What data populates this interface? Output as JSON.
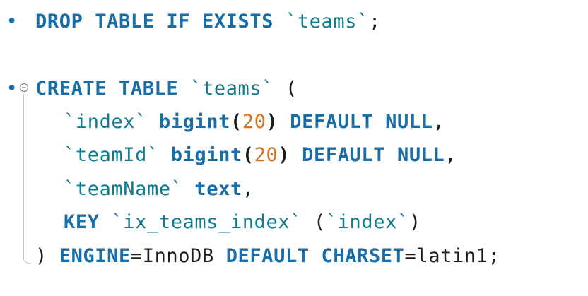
{
  "editor": {
    "lines": [
      {
        "tokens": [
          {
            "t": "kw",
            "v": "DROP TABLE IF EXISTS "
          },
          {
            "t": "id",
            "v": "`teams`"
          },
          {
            "t": "plain",
            "v": ";"
          }
        ]
      },
      {
        "tokens": [
          {
            "t": "kw",
            "v": "CREATE TABLE "
          },
          {
            "t": "id",
            "v": "`teams`"
          },
          {
            "t": "plain",
            "v": " ("
          }
        ]
      },
      {
        "tokens": [
          {
            "t": "id",
            "v": "`index`"
          },
          {
            "t": "plain",
            "v": " "
          },
          {
            "t": "kw",
            "v": "bigint"
          },
          {
            "t": "paren",
            "v": "("
          },
          {
            "t": "num",
            "v": "20"
          },
          {
            "t": "paren",
            "v": ")"
          },
          {
            "t": "kw",
            "v": " DEFAULT NULL"
          },
          {
            "t": "plain",
            "v": ","
          }
        ]
      },
      {
        "tokens": [
          {
            "t": "id",
            "v": "`teamId`"
          },
          {
            "t": "plain",
            "v": " "
          },
          {
            "t": "kw",
            "v": "bigint"
          },
          {
            "t": "paren",
            "v": "("
          },
          {
            "t": "num",
            "v": "20"
          },
          {
            "t": "paren",
            "v": ")"
          },
          {
            "t": "kw",
            "v": " DEFAULT NULL"
          },
          {
            "t": "plain",
            "v": ","
          }
        ]
      },
      {
        "tokens": [
          {
            "t": "id",
            "v": "`teamName`"
          },
          {
            "t": "plain",
            "v": " "
          },
          {
            "t": "kw",
            "v": "text"
          },
          {
            "t": "plain",
            "v": ","
          }
        ]
      },
      {
        "tokens": [
          {
            "t": "kw",
            "v": "KEY "
          },
          {
            "t": "id",
            "v": "`ix_teams_index`"
          },
          {
            "t": "plain",
            "v": " ("
          },
          {
            "t": "id",
            "v": "`index`"
          },
          {
            "t": "plain",
            "v": ")"
          }
        ]
      },
      {
        "tokens": [
          {
            "t": "plain",
            "v": ") "
          },
          {
            "t": "kw",
            "v": "ENGINE"
          },
          {
            "t": "plain",
            "v": "=InnoDB "
          },
          {
            "t": "kw",
            "v": "DEFAULT CHARSET"
          },
          {
            "t": "plain",
            "v": "=latin1;"
          }
        ]
      }
    ],
    "statement_bullet": "•",
    "fold_icon": "fold-collapse-icon"
  }
}
